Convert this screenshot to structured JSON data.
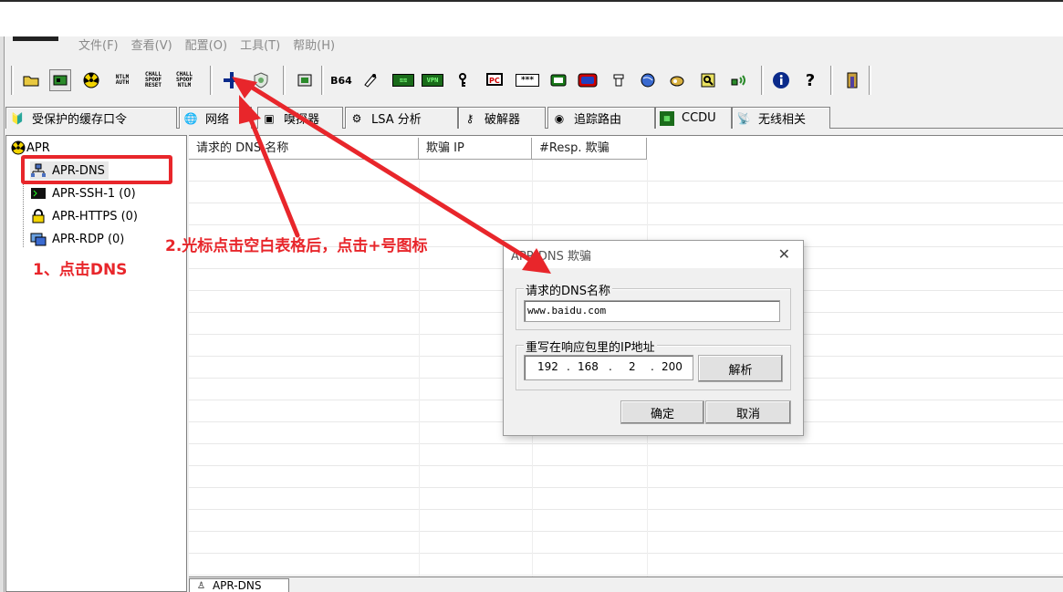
{
  "menu": {
    "items": [
      "文件(F)",
      "查看(V)",
      "配置(O)",
      "工具(T)",
      "帮助(H)"
    ]
  },
  "toolbar": {
    "icons": [
      "open-folder-icon",
      "network-card-icon",
      "radiation-icon",
      "ntlm-auth-icon",
      "chall-spoof-reset-icon",
      "chall-spoof-ntlm-icon",
      "add-plus-icon",
      "cert-shield-icon",
      "sniffer-toggle-icon",
      "base64-icon",
      "hash-icon",
      "green-tool-icon",
      "vpn-icon",
      "wireless-key-icon",
      "pc-icon",
      "password-icon",
      "calc-icon",
      "rsa-icon",
      "network-tool-icon",
      "globe-tool-icon",
      "key-tool-icon",
      "search-key-icon",
      "wifi-signal-icon",
      "info-icon",
      "help-icon",
      "exit-icon"
    ],
    "labels": {
      "ntlm_auth": "NTLM AUTH",
      "chall_reset": "CHALL SPOOF RESET",
      "chall_ntlm": "CHALL SPOOF NTLM",
      "b64": "B64",
      "green1": "≋≋",
      "vpn": "VPN",
      "pwd": "***",
      "pc": "PC"
    },
    "accent_plus": "#0a2a8a"
  },
  "tabs": [
    {
      "label": "受保护的缓存口令",
      "icon": "cache-icon"
    },
    {
      "label": "网络",
      "icon": "network-icon"
    },
    {
      "label": "嗅探器",
      "icon": "sniffer-icon"
    },
    {
      "label": "LSA 分析",
      "icon": "lsa-icon"
    },
    {
      "label": "破解器",
      "icon": "key-icon"
    },
    {
      "label": "追踪路由",
      "icon": "traceroute-icon"
    },
    {
      "label": "CCDU",
      "icon": "ccdu-icon"
    },
    {
      "label": "无线相关",
      "icon": "wireless-icon"
    }
  ],
  "tree": {
    "root": "APR",
    "children": [
      "APR-DNS",
      "APR-SSH-1 (0)",
      "APR-HTTPS (0)",
      "APR-RDP (0)"
    ]
  },
  "grid": {
    "columns": [
      "请求的 DNS 名称",
      "欺骗 IP",
      "#Resp. 欺骗"
    ]
  },
  "bottom_tab": "APR-DNS",
  "dialog": {
    "title": "APR DNS 欺骗",
    "close": "✕",
    "group1_label": "请求的DNS名称",
    "dns_value": "www.baidu.com",
    "group2_label": "重写在响应包里的IP地址",
    "ip": [
      "192",
      "168",
      "2",
      "200"
    ],
    "resolve_button": "解析",
    "ok_button": "确定",
    "cancel_button": "取消"
  },
  "annotations": {
    "step1": "1、点击DNS",
    "step2": "2.光标点击空白表格后，点击+号图标",
    "color": "#e8262b"
  }
}
